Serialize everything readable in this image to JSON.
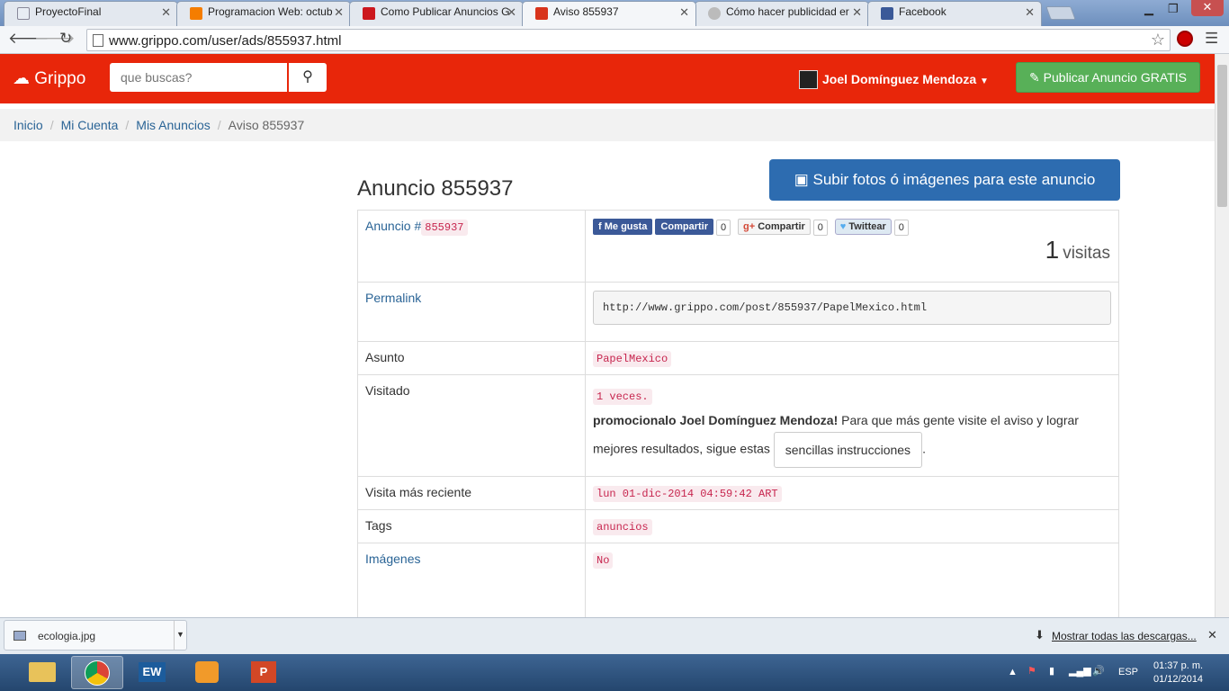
{
  "browser": {
    "tabs": [
      {
        "label": "ProyectoFinal",
        "favicon_color": "#e8edf4",
        "active": false
      },
      {
        "label": "Programacion Web: octub",
        "favicon_color": "#f57d00",
        "active": false
      },
      {
        "label": "Como Publicar Anuncios G",
        "favicon_color": "#cc181e",
        "active": false
      },
      {
        "label": "Aviso 855937",
        "favicon_color": "#d8341c",
        "active": true
      },
      {
        "label": "Cómo hacer publicidad er",
        "favicon_color": "#bbbbbb",
        "active": false
      },
      {
        "label": "Facebook",
        "favicon_color": "#3b5998",
        "active": false
      }
    ],
    "url": "www.grippo.com/user/ads/855937.html"
  },
  "header": {
    "logo": "Grippo",
    "search_placeholder": "que buscas?",
    "user_name": "Joel Domínguez Mendoza",
    "publish_label": "Publicar Anuncio GRATIS"
  },
  "breadcrumb": [
    "Inicio",
    "Mi Cuenta",
    "Mis Anuncios",
    "Aviso 855937"
  ],
  "main": {
    "title": "Anuncio 855937",
    "upload_label": "Subir fotos ó imágenes para este anuncio",
    "rows": {
      "anuncio_label": "Anuncio #",
      "anuncio_id": "855937",
      "social": {
        "like": "Me gusta",
        "share": "Compartir",
        "share_count": "0",
        "gplus": "Compartir",
        "gplus_count": "0",
        "tweet": "Twittear",
        "tweet_count": "0"
      },
      "visits_count": "1",
      "visits_label": "visitas",
      "permalink_label": "Permalink",
      "permalink": "http://www.grippo.com/post/855937/PapelMexico.html",
      "asunto_label": "Asunto",
      "asunto": "PapelMexico",
      "visitado_label": "Visitado",
      "visitado": "1 veces.",
      "promo_bold": "promocionalo Joel Domínguez Mendoza!",
      "promo_text": " Para que más gente visite el aviso y lograr mejores resultados, sigue estas ",
      "promo_button": "sencillas instrucciones",
      "promo_end": ".",
      "reciente_label": "Visita más reciente",
      "reciente": "lun 01-dic-2014 04:59:42 ART",
      "tags_label": "Tags",
      "tags": "anuncios",
      "imagenes_label": "Imágenes",
      "imagenes": "No"
    }
  },
  "downloads": {
    "file": "ecologia.jpg",
    "show_all": "Mostrar todas las descargas..."
  },
  "taskbar": {
    "lang": "ESP",
    "time": "01:37 p. m.",
    "date": "01/12/2014"
  }
}
